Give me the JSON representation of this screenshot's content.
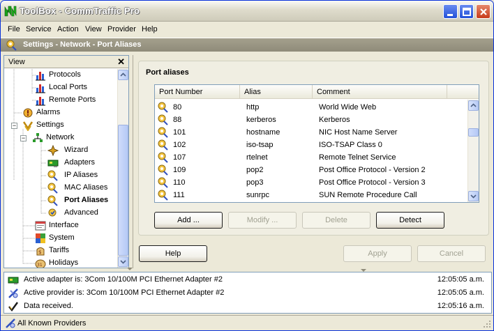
{
  "window": {
    "title": "ToolBox - CommTraffic Pro"
  },
  "menu": [
    "File",
    "Service",
    "Action",
    "View",
    "Provider",
    "Help"
  ],
  "header": {
    "breadcrumb": "Settings - Network - Port Aliases"
  },
  "view_panel": {
    "title": "View",
    "close": "✕",
    "tree": [
      {
        "label": "Protocols",
        "icon": "bar-chart-icon"
      },
      {
        "label": "Local Ports",
        "icon": "bar-chart-icon"
      },
      {
        "label": "Remote Ports",
        "icon": "bar-chart-icon"
      },
      {
        "label": "Alarms",
        "icon": "alarm-icon"
      },
      {
        "label": "Settings",
        "icon": "settings-icon"
      },
      {
        "label": "Network",
        "icon": "network-icon"
      },
      {
        "label": "Wizard",
        "icon": "wizard-icon"
      },
      {
        "label": "Adapters",
        "icon": "adapter-icon"
      },
      {
        "label": "IP Aliases",
        "icon": "alias-icon"
      },
      {
        "label": "MAC Aliases",
        "icon": "alias-icon"
      },
      {
        "label": "Port Aliases",
        "icon": "alias-icon",
        "selected": true
      },
      {
        "label": "Advanced",
        "icon": "advanced-icon"
      },
      {
        "label": "Interface",
        "icon": "interface-icon"
      },
      {
        "label": "System",
        "icon": "system-icon"
      },
      {
        "label": "Tariffs",
        "icon": "tariffs-icon"
      },
      {
        "label": "Holidays",
        "icon": "calendar-icon"
      }
    ]
  },
  "port_aliases": {
    "title": "Port aliases",
    "columns": [
      "Port Number",
      "Alias",
      "Comment"
    ],
    "rows": [
      {
        "port": "80",
        "alias": "http",
        "comment": "World Wide Web"
      },
      {
        "port": "88",
        "alias": "kerberos",
        "comment": "Kerberos"
      },
      {
        "port": "101",
        "alias": "hostname",
        "comment": "NIC Host Name Server"
      },
      {
        "port": "102",
        "alias": "iso-tsap",
        "comment": "ISO-TSAP Class 0"
      },
      {
        "port": "107",
        "alias": "rtelnet",
        "comment": "Remote Telnet Service"
      },
      {
        "port": "109",
        "alias": "pop2",
        "comment": "Post Office Protocol - Version 2"
      },
      {
        "port": "110",
        "alias": "pop3",
        "comment": "Post Office Protocol - Version 3"
      },
      {
        "port": "111",
        "alias": "sunrpc",
        "comment": "SUN Remote Procedure Call"
      }
    ],
    "buttons": {
      "add": "Add ...",
      "modify": "Modify ...",
      "delete": "Delete",
      "detect": "Detect"
    }
  },
  "dialog_buttons": {
    "help": "Help",
    "apply": "Apply",
    "cancel": "Cancel"
  },
  "log": [
    {
      "message": "Active adapter is: 3Com 10/100M PCI Ethernet Adapter #2",
      "time": "12:05:05 a.m.",
      "icon": "adapter-icon"
    },
    {
      "message": "Active provider is: 3Com 10/100M PCI Ethernet Adapter #2",
      "time": "12:05:05 a.m.",
      "icon": "provider-icon"
    },
    {
      "message": "Data received.",
      "time": "12:05:16 a.m.",
      "icon": "check-icon"
    }
  ],
  "status": {
    "text": "All Known Providers"
  },
  "colors": {
    "title_blue": "#0831d9",
    "header_strip": "#a4a08d",
    "accent_green": "#2a9a2a"
  }
}
